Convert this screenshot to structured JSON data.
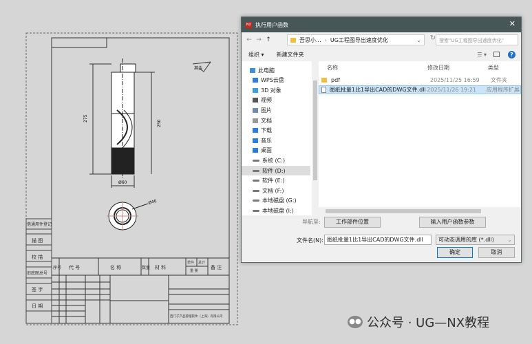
{
  "drawing": {
    "roughness_label": "其余",
    "dim_total": "275",
    "dim_partial": "250",
    "dim_diameter": "Ø60",
    "dim_circle": "Ø40",
    "left_column": [
      "借通用件登记",
      "描 图",
      "校 描",
      "旧底图总号",
      "签 字",
      "日 期"
    ],
    "table_header": [
      "序号",
      "代 号",
      "名 称",
      "数量",
      "材 料",
      "单件",
      "总计",
      "重 量",
      "备 注"
    ],
    "company": "西门子产品管理软件（上海）有限公司"
  },
  "dialog": {
    "title": "执行用户函数",
    "icon_text": "NX",
    "close": "✕",
    "nav_back": "←",
    "nav_forward": "→",
    "nav_up": "↑",
    "path": [
      "吾思小...",
      "UG工程图导出速度优化"
    ],
    "search_placeholder": "搜索\"UG工程图导出速度优化\"",
    "organize": "组织 ▾",
    "new_folder": "新建文件夹",
    "sidebar": [
      {
        "label": "此电脑",
        "icon": "computer-icon",
        "color": "#3a8ee6"
      },
      {
        "label": "WPS云盘",
        "icon": "cloud-icon",
        "color": "#2a7de1"
      },
      {
        "label": "3D 对象",
        "icon": "cube-icon",
        "color": "#3aa0d8"
      },
      {
        "label": "视频",
        "icon": "video-icon",
        "color": "#555"
      },
      {
        "label": "图片",
        "icon": "picture-icon",
        "color": "#6a8caf"
      },
      {
        "label": "文档",
        "icon": "document-icon",
        "color": "#999"
      },
      {
        "label": "下载",
        "icon": "download-icon",
        "color": "#2a7de1"
      },
      {
        "label": "音乐",
        "icon": "music-icon",
        "color": "#2a7de1"
      },
      {
        "label": "桌面",
        "icon": "desktop-icon",
        "color": "#2a7de1"
      },
      {
        "label": "系统 (C:)",
        "icon": "drive-icon",
        "color": "#777"
      },
      {
        "label": "软件 (D:)",
        "icon": "drive-icon",
        "color": "#777",
        "selected": true
      },
      {
        "label": "软件 (E:)",
        "icon": "drive-icon",
        "color": "#777"
      },
      {
        "label": "文档 (F:)",
        "icon": "drive-icon",
        "color": "#777"
      },
      {
        "label": "本地磁盘 (G:)",
        "icon": "drive-icon",
        "color": "#777"
      },
      {
        "label": "本地磁盘 (I:)",
        "icon": "drive-icon",
        "color": "#777"
      }
    ],
    "columns": {
      "name": "名称",
      "modified": "修改日期",
      "type": "类型"
    },
    "files": [
      {
        "name": "pdf",
        "modified": "2025/11/25 16:59",
        "type": "文件夹",
        "icon": "folder-icon"
      },
      {
        "name": "图纸批量1比1导出CAD的DWG文件.dll",
        "modified": "2025/11/26 19:21",
        "type": "应用程序扩展",
        "icon": "dll-file-icon",
        "selected": true
      }
    ],
    "navigate_label": "导航至:",
    "work_part_button": "工作部件位置",
    "user_params_button": "输入用户函数参数",
    "filename_label": "文件名(N):",
    "filename_value": "图纸批量1比1导出CAD的DWG文件.dll",
    "filter_value": "可动态调用的库 (*.dll)",
    "ok": "确定",
    "cancel": "取消"
  },
  "watermark": "公众号 · UG—NX教程"
}
